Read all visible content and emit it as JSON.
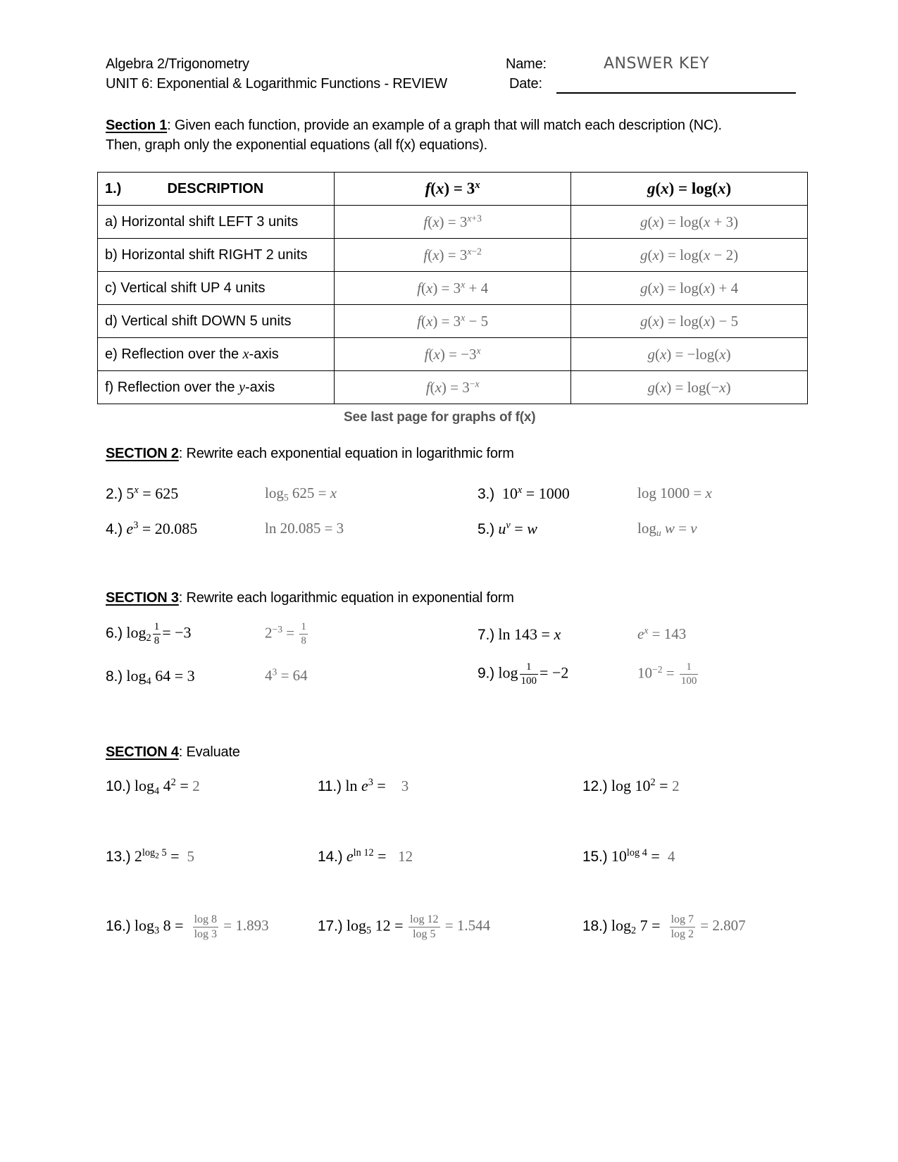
{
  "header": {
    "course": "Algebra 2/Trigonometry",
    "unit": "UNIT 6:  Exponential & Logarithmic Functions - REVIEW",
    "name_label": "Name:",
    "name_value": "ANSWER KEY",
    "date_label": "Date:",
    "date_blank": "____________________________"
  },
  "section1": {
    "title": "Section 1",
    "instructions_1": ":  Given each function, provide an example of a graph that will match each description (NC).",
    "instructions_2": "Then, graph only the exponential equations (all f(x) equations).",
    "table": {
      "num": "1.)",
      "col_description": "DESCRIPTION",
      "col_f": "f(x) = 3^x",
      "col_g": "g(x) = log(x)",
      "rows": [
        {
          "description": "a) Horizontal shift LEFT 3 units",
          "f": "f(x) = 3^(x+3)",
          "g": "g(x) = log(x + 3)"
        },
        {
          "description": "b) Horizontal shift RIGHT 2 units",
          "f": "f(x) = 3^(x−2)",
          "g": "g(x) = log(x − 2)"
        },
        {
          "description": "c) Vertical shift UP 4 units",
          "f": "f(x) = 3^x + 4",
          "g": "g(x) = log(x) + 4"
        },
        {
          "description": "d) Vertical shift DOWN 5 units",
          "f": "f(x) = 3^x − 5",
          "g": "g(x) = log(x) − 5"
        },
        {
          "description": "e) Reflection over the x-axis",
          "f": "f(x) = −3^x",
          "g": "g(x) = −log(x)"
        },
        {
          "description": "f) Reflection over the y-axis",
          "f": "f(x) = 3^(−x)",
          "g": "g(x) = log(−x)"
        }
      ]
    },
    "note": "See last page for graphs of f(x)"
  },
  "section2": {
    "title": "SECTION 2",
    "instructions": ":  Rewrite each exponential equation in logarithmic form",
    "problems": [
      {
        "num": "2.)",
        "question": "5^x = 625",
        "answer": "log_5 625 = x"
      },
      {
        "num": "3.)",
        "question": "10^x = 1000",
        "answer": "log 1000 = x"
      },
      {
        "num": "4.)",
        "question": "e^3 = 20.085",
        "answer": "ln 20.085 = 3"
      },
      {
        "num": "5.)",
        "question": "u^v = w",
        "answer": "log_u w = v"
      }
    ]
  },
  "section3": {
    "title": "SECTION 3",
    "instructions": ":  Rewrite each logarithmic equation in exponential form",
    "problems": [
      {
        "num": "6.)",
        "question": "log_2 (1/8) = −3",
        "answer": "2^(−3) = 1/8"
      },
      {
        "num": "7.)",
        "question": "ln 143 = x",
        "answer": "e^x = 143"
      },
      {
        "num": "8.)",
        "question": "log_4 64 = 3",
        "answer": "4^3 = 64"
      },
      {
        "num": "9.)",
        "question": "log (1/100) = −2",
        "answer": "10^(−2) = 1/100"
      }
    ]
  },
  "section4": {
    "title": "SECTION 4",
    "instructions": ":  Evaluate",
    "problems": [
      {
        "num": "10.)",
        "question": "log_4 4^2 =",
        "answer": "2"
      },
      {
        "num": "11.)",
        "question": "ln e^3 =",
        "answer": "3"
      },
      {
        "num": "12.)",
        "question": "log 10^2 =",
        "answer": "2"
      },
      {
        "num": "13.)",
        "question": "2^(log_2 5) =",
        "answer": "5"
      },
      {
        "num": "14.)",
        "question": "e^(ln 12) =",
        "answer": "12"
      },
      {
        "num": "15.)",
        "question": "10^(log 4) =",
        "answer": "4"
      },
      {
        "num": "16.)",
        "question": "log_3 8 =",
        "answer": "log 8 / log 3 = 1.893"
      },
      {
        "num": "17.)",
        "question": "log_5 12 =",
        "answer": "log 12 / log 5 = 1.544"
      },
      {
        "num": "18.)",
        "question": "log_2 7 =",
        "answer": "log 7 / log 2 = 2.807"
      }
    ]
  }
}
